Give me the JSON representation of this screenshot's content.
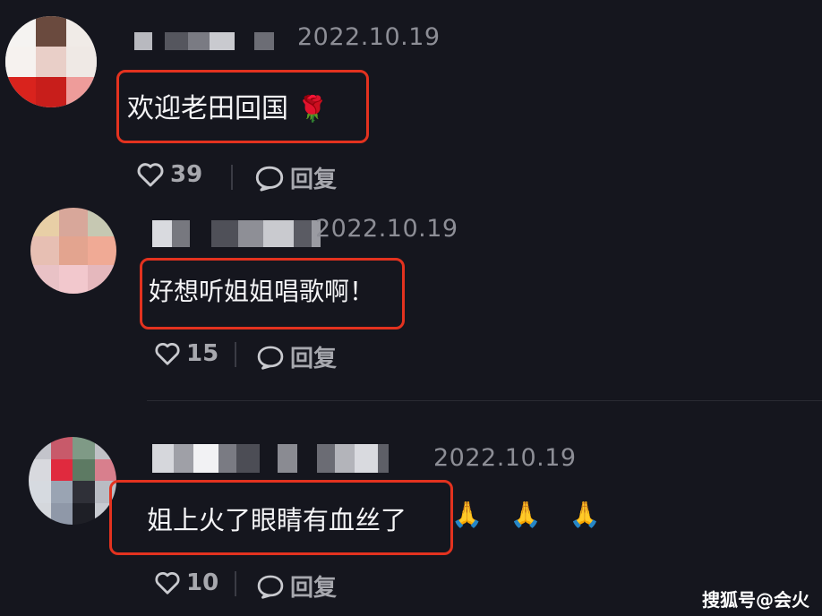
{
  "comments": [
    {
      "date": "2022.10.19",
      "text": "欢迎老田回国",
      "emoji": "🌹",
      "likes": "39",
      "reply_label": "回复"
    },
    {
      "date": "2022.10.19",
      "text": "好想听姐姐唱歌啊！",
      "likes": "15",
      "reply_label": "回复"
    },
    {
      "date": "2022.10.19",
      "text": "姐上火了眼睛有血丝了",
      "emoji": "🙏 🙏 🙏",
      "likes": "10",
      "reply_label": "回复"
    }
  ],
  "watermark": "搜狐号@会火",
  "icons": {
    "like": "heart-icon",
    "reply": "speech-bubble-icon"
  },
  "colors": {
    "highlight": "#e3321f",
    "background": "#15161e"
  }
}
